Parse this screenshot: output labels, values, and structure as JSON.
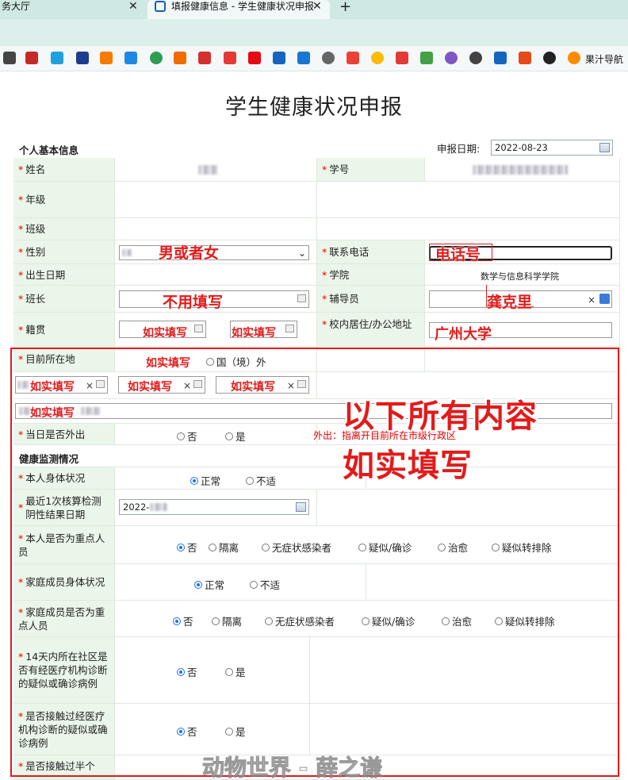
{
  "browser": {
    "tab1_label": "务大厅",
    "tab2_label": "填报健康信息 - 学生健康状况申报",
    "bookmark_last": "果汁导航"
  },
  "page": {
    "title": "学生健康状况申报",
    "section_basic": "个人基本信息",
    "report_date_label": "申报日期:",
    "report_date_value": "2022-08-23",
    "section_health": "健康监测情况"
  },
  "fields": {
    "name": "姓名",
    "student_id": "学号",
    "grade": "年级",
    "class": "班级",
    "gender": "性别",
    "phone": "联系电话",
    "birth": "出生日期",
    "college": "学院",
    "college_value": "数学与信息科学学院",
    "monitor": "班长",
    "counselor": "辅导员",
    "native": "籍贯",
    "campus_address": "校内居住/办公地址",
    "location": "目前所在地",
    "location_option_abroad": "国（境）外",
    "out_today": "当日是否外出",
    "out_note": "外出：指离开目前所在市级行政区",
    "body": "本人身体状况",
    "nucleic": "最近1次核算检测阴性结果日期",
    "nucleic_value": "2022-",
    "key_person": "本人是否为重点人员",
    "family_body": "家庭成员身体状况",
    "family_key": "家庭成员是否为重点人员",
    "community": "14天内所在社区是否有经医疗机构诊断的疑似或确诊病例",
    "contact": "是否接触过经医疗机构诊断的疑似或确诊病例",
    "contact_half": "是否接触过半个"
  },
  "options": {
    "no": "否",
    "yes": "是",
    "normal": "正常",
    "unwell": "不适",
    "quarantine": "隔离",
    "asymptomatic": "无症状感染者",
    "suspected": "疑似/确诊",
    "cured": "治愈",
    "excluded": "疑似转排除"
  },
  "annotations": {
    "gender": "男或者女",
    "phone": "电话号",
    "monitor": "不用填写",
    "counselor": "龚克里",
    "fill_truth": "如实填写",
    "campus": "广州大学",
    "all_below_line1": "以下所有内容",
    "all_below_line2": "如实填写",
    "watermark": "动物世界 - 薛之谦"
  }
}
